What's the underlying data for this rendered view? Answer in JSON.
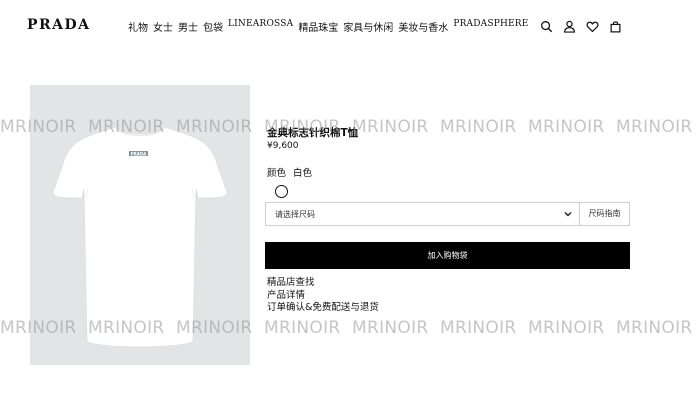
{
  "brand": {
    "logo": "PRADA"
  },
  "nav": {
    "items": [
      "礼物",
      "女士",
      "男士",
      "包袋",
      "LINEAROSSA",
      "精品珠宝",
      "家具与休闲",
      "美妆与香水",
      "PRADASPHERE"
    ]
  },
  "header_icons": [
    "search-icon",
    "user-icon",
    "heart-icon",
    "shopping-bag-icon"
  ],
  "product": {
    "title": "金典标志针织棉T恤",
    "price": "¥9,600",
    "color_label": "颜色",
    "color_value": "白色",
    "size_placeholder": "请选择尺码",
    "size_guide": "尺码指南",
    "add_to_bag": "加入购物袋",
    "links": [
      "精品店查找",
      "产品详情",
      "订单确认&免费配送与退货"
    ],
    "image_tag": "PRADA"
  },
  "watermark": {
    "text": "MRINOIR"
  },
  "colors": {
    "accent": "#000000",
    "image_bg": "#e3e4e6",
    "shirt": "#ffffff"
  }
}
